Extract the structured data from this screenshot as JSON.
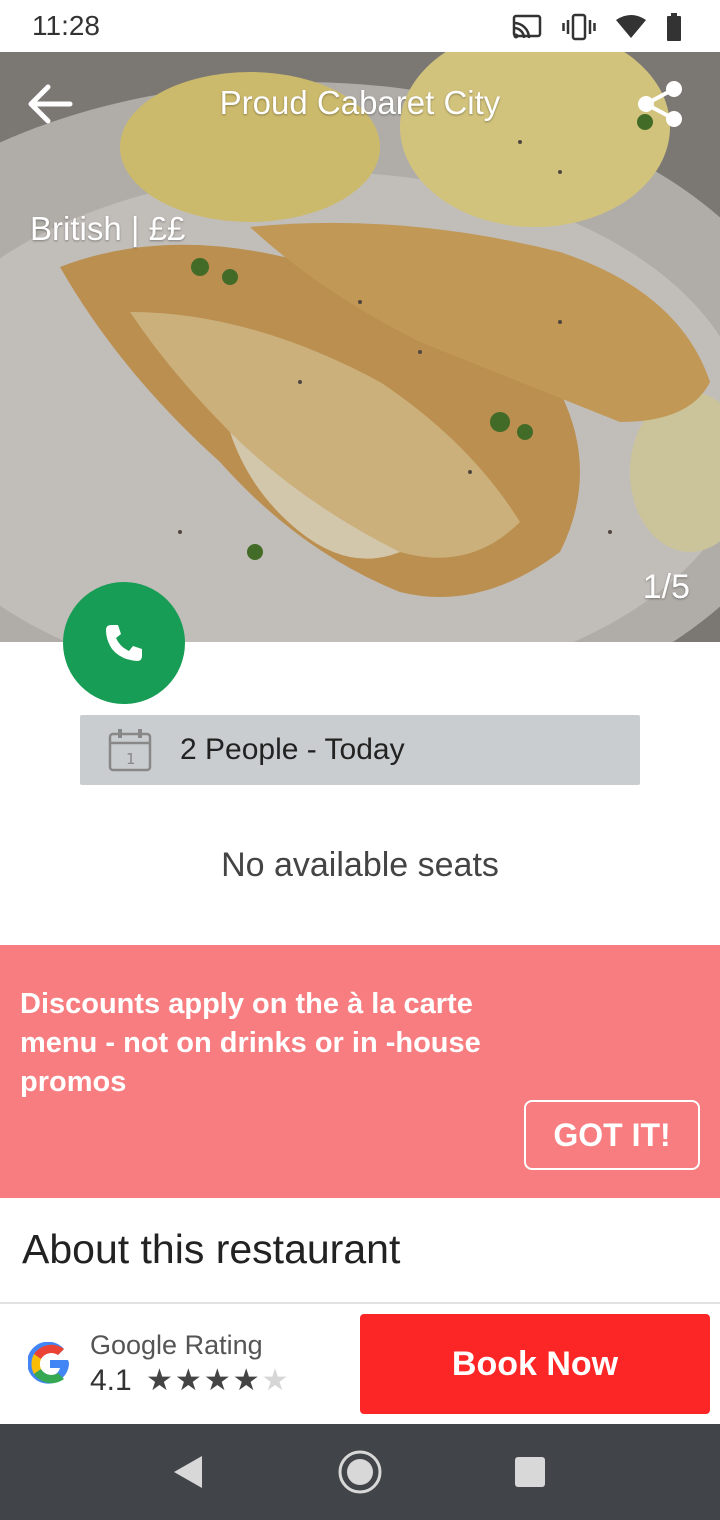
{
  "status_bar": {
    "time": "11:28",
    "icons": [
      "cast-icon",
      "vibrate-icon",
      "wifi-icon",
      "battery-icon"
    ]
  },
  "header": {
    "title": "Proud Cabaret City",
    "back_icon": "arrow-left-icon",
    "share_icon": "share-icon"
  },
  "hero": {
    "cuisine": "British | ££",
    "image_counter": "1/5"
  },
  "call_button": {
    "icon": "phone-icon",
    "color": "#179d55"
  },
  "booking": {
    "icon": "calendar-icon",
    "selection": "2 People - Today"
  },
  "availability": {
    "message": "No available seats"
  },
  "promo": {
    "message": "Discounts apply on the à la carte menu - not on drinks or in -house promos",
    "button_label": "GOT IT!",
    "color": "#f77d80"
  },
  "about": {
    "heading": "About this restaurant"
  },
  "rating": {
    "label": "Google Rating",
    "value": "4.1",
    "stars_filled": 4,
    "stars_total": 5,
    "logo": "google-logo"
  },
  "book_button": {
    "label": "Book Now",
    "color": "#fc2626"
  },
  "nav_bar": {
    "buttons": [
      "back-triangle-icon",
      "home-circle-icon",
      "recents-square-icon"
    ]
  }
}
